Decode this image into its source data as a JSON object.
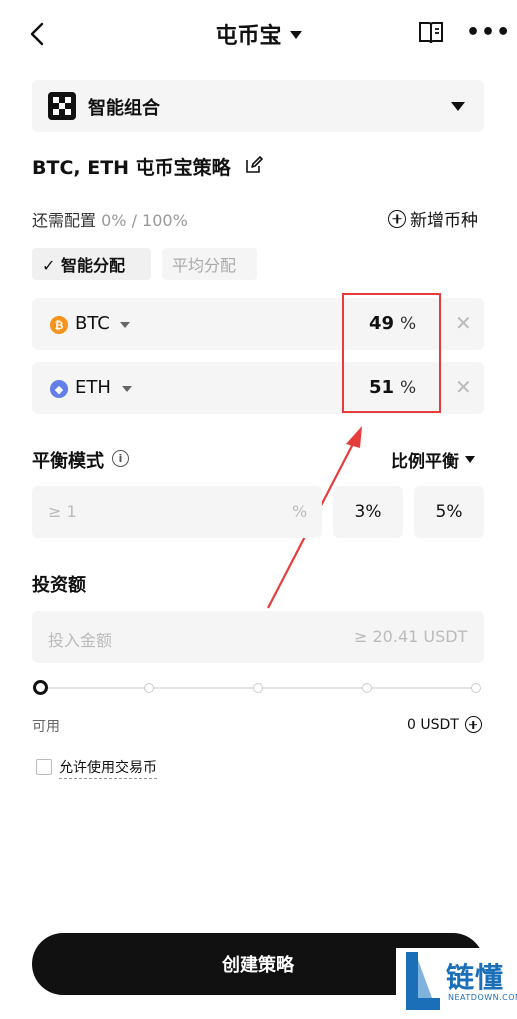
{
  "header": {
    "title": "屯币宝"
  },
  "portfolio": {
    "label": "智能组合"
  },
  "strategy": {
    "title": "BTC, ETH 屯币宝策略"
  },
  "allocation": {
    "need_label": "还需配置",
    "need_value": "0% / 100%",
    "add_coin": "新增币种",
    "tabs": [
      {
        "label": "✓ 智能分配",
        "active": true
      },
      {
        "label": "平均分配",
        "active": false
      }
    ],
    "coins": [
      {
        "symbol": "BTC",
        "icon_char": "₿",
        "percent": "49",
        "unit": "%",
        "color": "#f7931a"
      },
      {
        "symbol": "ETH",
        "icon_char": "◆",
        "percent": "51",
        "unit": "%",
        "color": "#627eea"
      }
    ]
  },
  "balance": {
    "label": "平衡模式",
    "mode": "比例平衡",
    "input_placeholder": "≥ 1",
    "input_unit": "%",
    "presets": [
      "3%",
      "5%"
    ]
  },
  "investment": {
    "label": "投资额",
    "placeholder": "投入金额",
    "min": "≥ 20.41 USDT",
    "slider_level": 0,
    "available_label": "可用",
    "available_value": "0 USDT"
  },
  "options": {
    "allow_trade_coin": "允许使用交易币",
    "allow_trade_coin_checked": false
  },
  "cta": {
    "label": "创建策略"
  },
  "watermark": {
    "text": "链懂",
    "sub": "NEATDOWN.COM"
  },
  "colors": {
    "annotation_red": "#e63c3c",
    "btc": "#f7931a",
    "eth": "#627eea"
  }
}
